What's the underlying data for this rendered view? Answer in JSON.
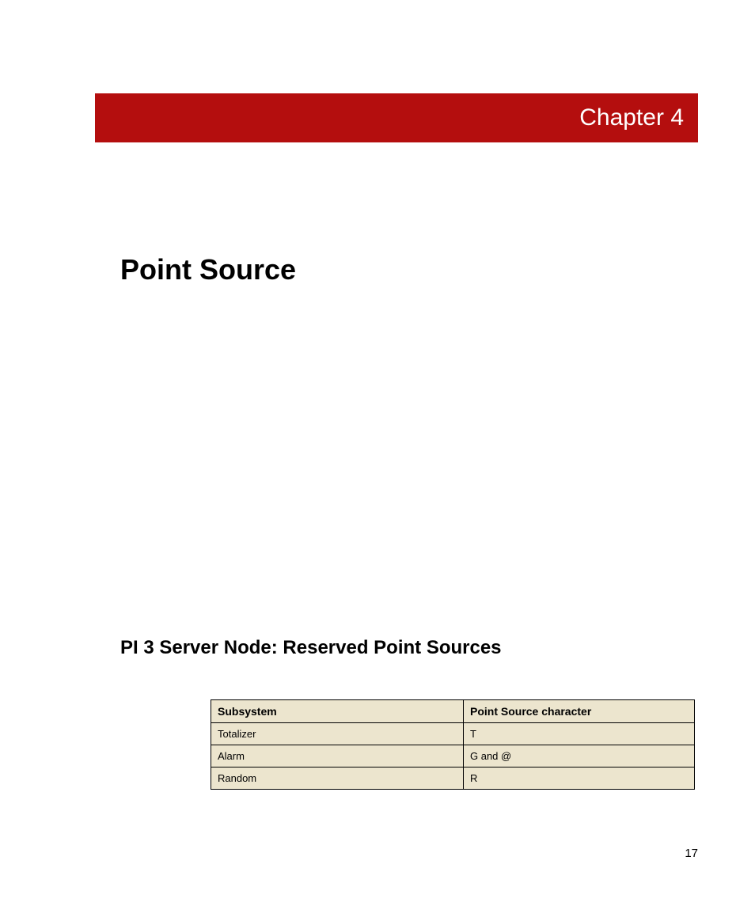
{
  "chapter_label": "Chapter 4",
  "page_title": "Point Source",
  "section_heading": "PI 3 Server Node: Reserved Point Sources",
  "table": {
    "headers": [
      "Subsystem",
      "Point Source character"
    ],
    "rows": [
      [
        "Totalizer",
        "T"
      ],
      [
        "Alarm",
        "G and @"
      ],
      [
        "Random",
        "R"
      ]
    ]
  },
  "page_number": "17"
}
